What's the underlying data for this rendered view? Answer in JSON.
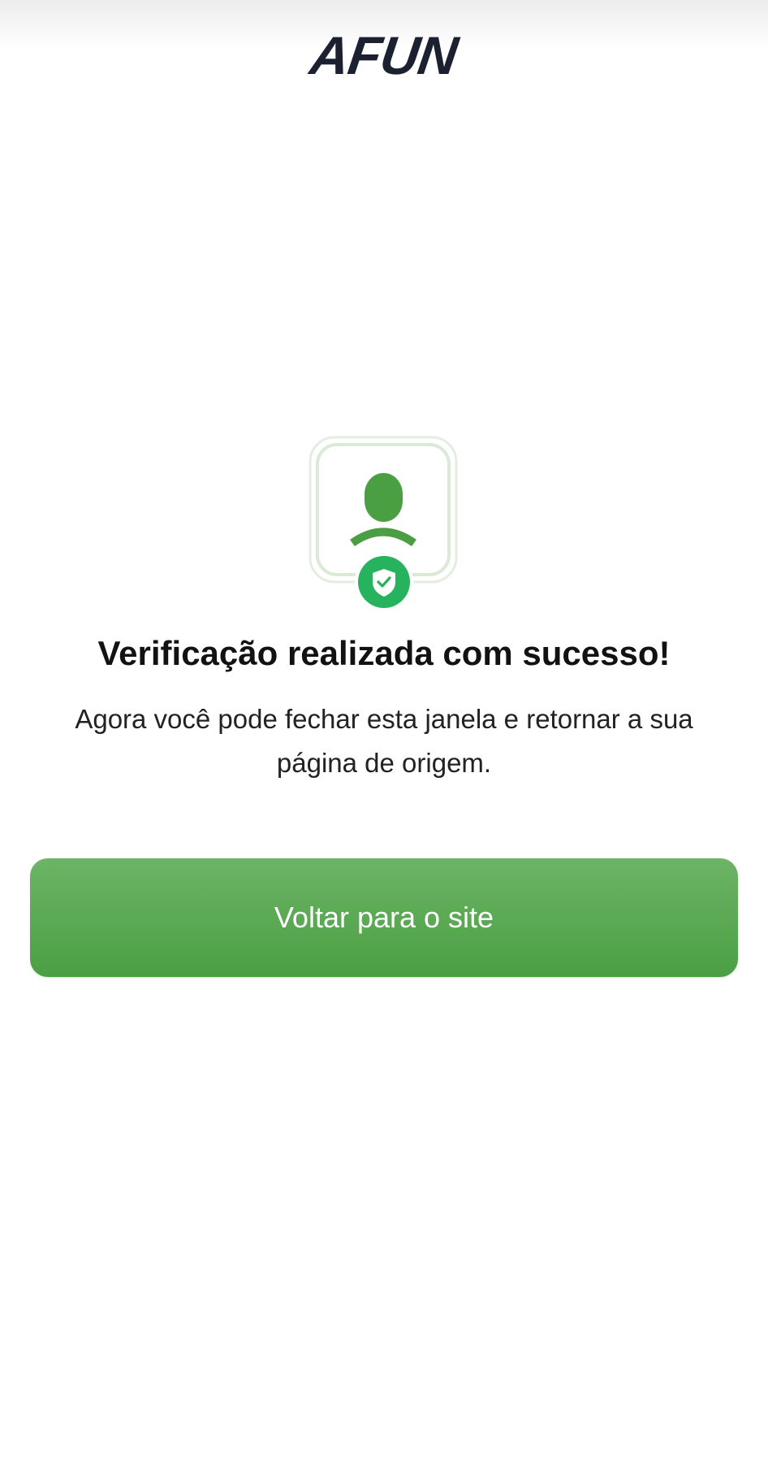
{
  "brand": {
    "logo_text": "AFUN"
  },
  "illustration": {
    "icon": "user-verified-icon",
    "badge_icon": "shield-check-icon",
    "colors": {
      "person": "#4b9f43",
      "badge": "#27b35e",
      "frame": "#dbe9d7"
    }
  },
  "main": {
    "title": "Verificação realizada com sucesso!",
    "message": "Agora você pode fechar esta janela e retornar a sua página de origem.",
    "button_label": "Voltar para o site"
  },
  "theme": {
    "accent": "#4b9f43",
    "accent_light": "#6cb466",
    "text_primary": "#121212",
    "background": "#ffffff"
  }
}
